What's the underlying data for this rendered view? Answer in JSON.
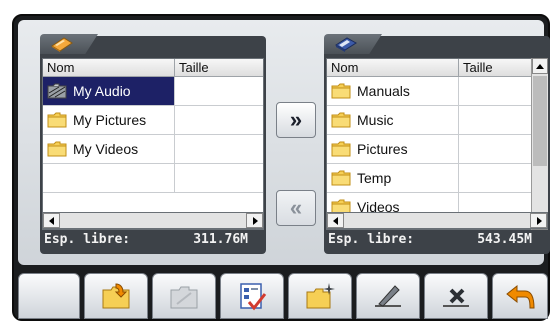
{
  "left_panel": {
    "columns": {
      "name": "Nom",
      "size": "Taille"
    },
    "rows": [
      {
        "name": "My Audio",
        "icon": "audio-folder-icon",
        "selected": true
      },
      {
        "name": "My Pictures",
        "icon": "folder-icon",
        "selected": false
      },
      {
        "name": "My Videos",
        "icon": "folder-icon",
        "selected": false
      },
      {
        "name": "",
        "icon": "",
        "selected": false
      },
      {
        "name": "",
        "icon": "",
        "selected": false
      }
    ],
    "free_label": "Esp. libre:",
    "free_value": "311.76M"
  },
  "right_panel": {
    "columns": {
      "name": "Nom",
      "size": "Taille"
    },
    "rows": [
      {
        "name": "Manuals",
        "icon": "folder-icon"
      },
      {
        "name": "Music",
        "icon": "folder-icon"
      },
      {
        "name": "Pictures",
        "icon": "folder-icon"
      },
      {
        "name": "Temp",
        "icon": "folder-icon"
      },
      {
        "name": "Videos",
        "icon": "folder-icon"
      }
    ],
    "free_label": "Esp. libre:",
    "free_value": "543.45M"
  },
  "transfer": {
    "copy_right": "»",
    "copy_left": "«"
  },
  "toolbar": [
    {
      "icon": "move-up-folder-icon"
    },
    {
      "icon": "disabled-folder-icon"
    },
    {
      "icon": "select-all-icon"
    },
    {
      "icon": "new-folder-icon"
    },
    {
      "icon": "rename-icon"
    },
    {
      "icon": "delete-icon"
    },
    {
      "icon": "back-arrow-icon"
    }
  ],
  "colors": {
    "selection": "#1d2166",
    "frame": "#1b1d1f",
    "folder": "#f2c23e",
    "accent_orange": "#f08a00",
    "delete_red": "#d23b2f"
  }
}
